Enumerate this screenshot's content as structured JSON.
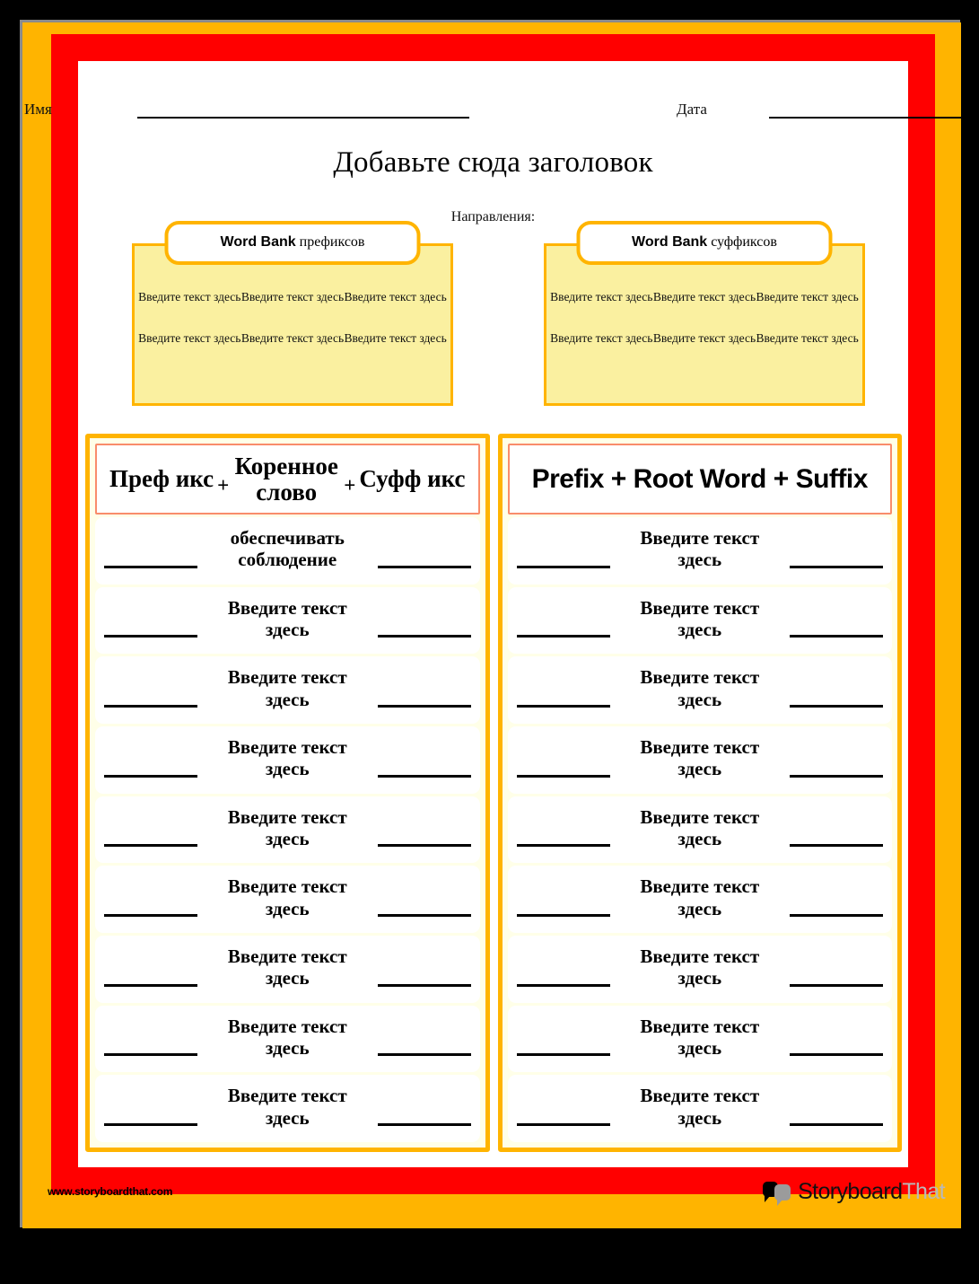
{
  "page": {
    "name_label": "Имя",
    "date_label": "Дата",
    "title": "Добавьте сюда заголовок",
    "directions": "Направления:"
  },
  "word_banks": [
    {
      "id": "prefix-word-bank",
      "title_bold": "Word Bank",
      "title_rest": " префиксов",
      "cells": [
        "Введите текст здесь",
        "Введите текст здесь",
        "Введите текст здесь",
        "Введите текст здесь",
        "Введите текст здесь",
        "Введите текст здесь"
      ]
    },
    {
      "id": "suffix-word-bank",
      "title_bold": "Word Bank",
      "title_rest": " суффиксов",
      "cells": [
        "Введите текст здесь",
        "Введите текст здесь",
        "Введите текст здесь",
        "Введите текст здесь",
        "Введите текст здесь",
        "Введите текст здесь"
      ]
    }
  ],
  "table": {
    "left_panel": {
      "header_parts": [
        "Преф икс",
        "+",
        "Коренное слово",
        "+",
        "Суфф икс"
      ],
      "rows": [
        "обеспечивать соблюдение",
        "Введите текст здесь",
        "Введите текст здесь",
        "Введите текст здесь",
        "Введите текст здесь",
        "Введите текст здесь",
        "Введите текст здесь",
        "Введите текст здесь",
        "Введите текст здесь"
      ]
    },
    "right_panel": {
      "header": "Prefix + Root Word + Suffix",
      "rows": [
        "Введите текст здесь",
        "Введите текст здесь",
        "Введите текст здесь",
        "Введите текст здесь",
        "Введите текст здесь",
        "Введите текст здесь",
        "Введите текст здесь",
        "Введите текст здесь",
        "Введите текст здесь"
      ]
    }
  },
  "footer": {
    "url": "www.storyboardthat.com",
    "logo_part1": "Storyboard",
    "logo_part2": "That"
  },
  "colors": {
    "outer_background": "#000000",
    "frame_orange": "#FFB400",
    "frame_red": "#FF0000",
    "page_white": "#FFFFFF",
    "wordbank_fill": "#FAF0A0",
    "panel_fill": "#FFFFE8",
    "row_fill": "#FFFFFF",
    "header_border": "#F98C6B",
    "logo_grey": "#B9B9B9"
  }
}
